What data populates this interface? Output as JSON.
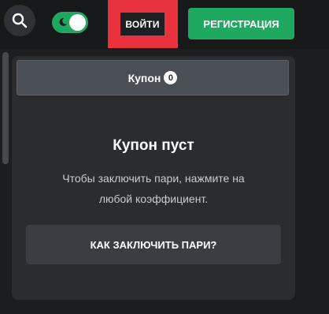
{
  "header": {
    "search_icon": "search-icon",
    "theme_toggle": {
      "icon": "moon-icon",
      "state": "on",
      "color": "#1fa860"
    },
    "login_label": "ВОЙТИ",
    "register_label": "РЕГИСТРАЦИЯ",
    "highlight_color": "#e8323d"
  },
  "coupon": {
    "tab_label": "Купон",
    "count": "0",
    "empty_title": "Купон пуст",
    "empty_line1": "Чтобы заключить пари, нажмите на",
    "empty_line2": "любой коэффициент.",
    "howto_label": "КАК ЗАКЛЮЧИТЬ ПАРИ?"
  },
  "colors": {
    "accent_green": "#1fa860",
    "panel_bg": "#2a2c30",
    "page_bg": "#1b1d20"
  }
}
